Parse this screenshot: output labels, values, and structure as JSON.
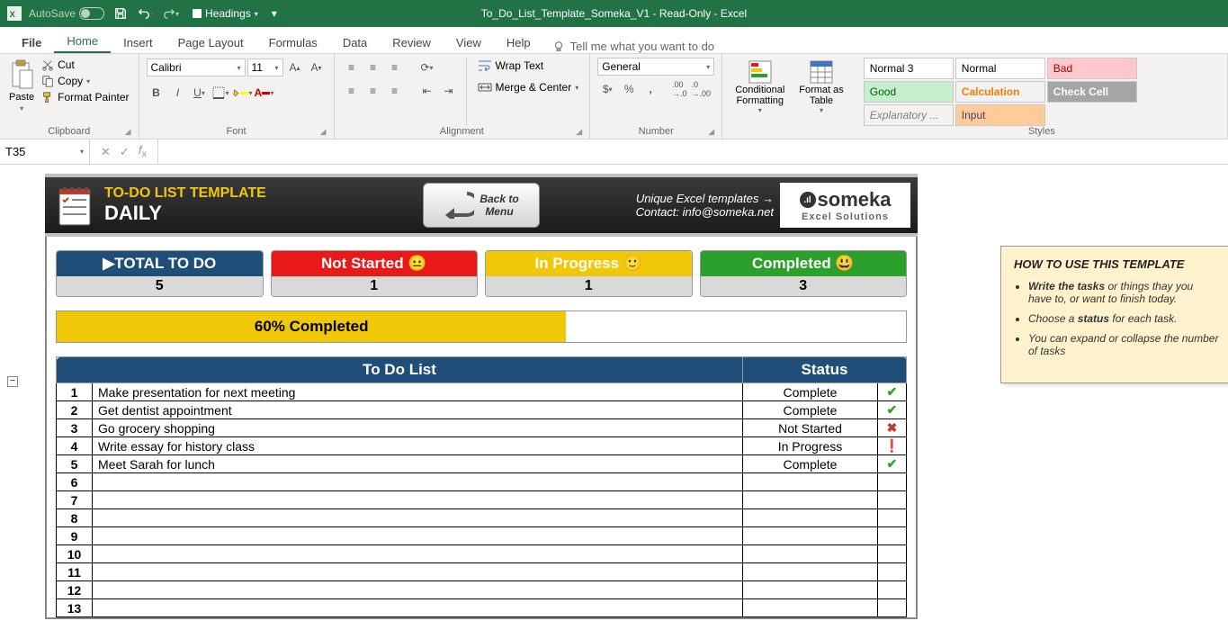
{
  "titlebar": {
    "autosave": "AutoSave",
    "saved": "",
    "title": "To_Do_List_Template_Someka_V1  -  Read-Only  -  Excel",
    "styleDropdown": "Headings"
  },
  "tabs": {
    "file": "File",
    "home": "Home",
    "insert": "Insert",
    "pagelayout": "Page Layout",
    "formulas": "Formulas",
    "data": "Data",
    "review": "Review",
    "view": "View",
    "help": "Help",
    "tellme": "Tell me what you want to do"
  },
  "ribbon": {
    "clipboard": {
      "paste": "Paste",
      "cut": "Cut",
      "copy": "Copy",
      "formatPainter": "Format Painter",
      "title": "Clipboard"
    },
    "font": {
      "name": "Calibri",
      "size": "11",
      "title": "Font"
    },
    "alignment": {
      "wrap": "Wrap Text",
      "merge": "Merge & Center",
      "title": "Alignment"
    },
    "number": {
      "format": "General",
      "title": "Number"
    },
    "cond": "Conditional\nFormatting",
    "formatTable": "Format as\nTable",
    "styles": {
      "normal3": "Normal 3",
      "normal": "Normal",
      "bad": "Bad",
      "good": "Good",
      "calculation": "Calculation",
      "checkCell": "Check Cell",
      "explanatory": "Explanatory ...",
      "input": "Input",
      "title": "Styles"
    }
  },
  "formulaBar": {
    "cellRef": "T35"
  },
  "template": {
    "title": "TO-DO LIST TEMPLATE",
    "subtitle": "DAILY",
    "backBtn": "Back to\nMenu",
    "unique": "Unique Excel templates →",
    "contact": "Contact: info@someka.net",
    "logoMain": "someka",
    "logoSub": "Excel Solutions"
  },
  "stats": {
    "totalLabel": "▶TOTAL TO DO",
    "totalVal": "5",
    "notStartedLabel": "Not Started 😐",
    "notStartedVal": "1",
    "inProgressLabel": "In Progress 🙂",
    "inProgressVal": "1",
    "completedLabel": "Completed 😃",
    "completedVal": "3",
    "progressText": "60% Completed"
  },
  "listTable": {
    "headerTodo": "To Do List",
    "headerStatus": "Status",
    "rows": [
      {
        "num": "1",
        "task": "Make presentation for next meeting",
        "status": "Complete",
        "icon": "✔"
      },
      {
        "num": "2",
        "task": "Get dentist appointment",
        "status": "Complete",
        "icon": "✔"
      },
      {
        "num": "3",
        "task": "Go grocery shopping",
        "status": "Not Started",
        "icon": "✖"
      },
      {
        "num": "4",
        "task": "Write essay for history class",
        "status": "In Progress",
        "icon": "❗"
      },
      {
        "num": "5",
        "task": "Meet Sarah for lunch",
        "status": "Complete",
        "icon": "✔"
      },
      {
        "num": "6",
        "task": "",
        "status": "",
        "icon": ""
      },
      {
        "num": "7",
        "task": "",
        "status": "",
        "icon": ""
      },
      {
        "num": "8",
        "task": "",
        "status": "",
        "icon": ""
      },
      {
        "num": "9",
        "task": "",
        "status": "",
        "icon": ""
      },
      {
        "num": "10",
        "task": "",
        "status": "",
        "icon": ""
      },
      {
        "num": "11",
        "task": "",
        "status": "",
        "icon": ""
      },
      {
        "num": "12",
        "task": "",
        "status": "",
        "icon": ""
      },
      {
        "num": "13",
        "task": "",
        "status": "",
        "icon": ""
      }
    ]
  },
  "howto": {
    "heading": "HOW TO USE THIS TEMPLATE",
    "bullet1a": "Write the tasks",
    "bullet1b": " or things thay you have to, or want to finish today.",
    "bullet2a": "Choose a ",
    "bullet2b": "status",
    "bullet2c": " for each task.",
    "bullet3": "You can expand or collapse the number of tasks"
  }
}
